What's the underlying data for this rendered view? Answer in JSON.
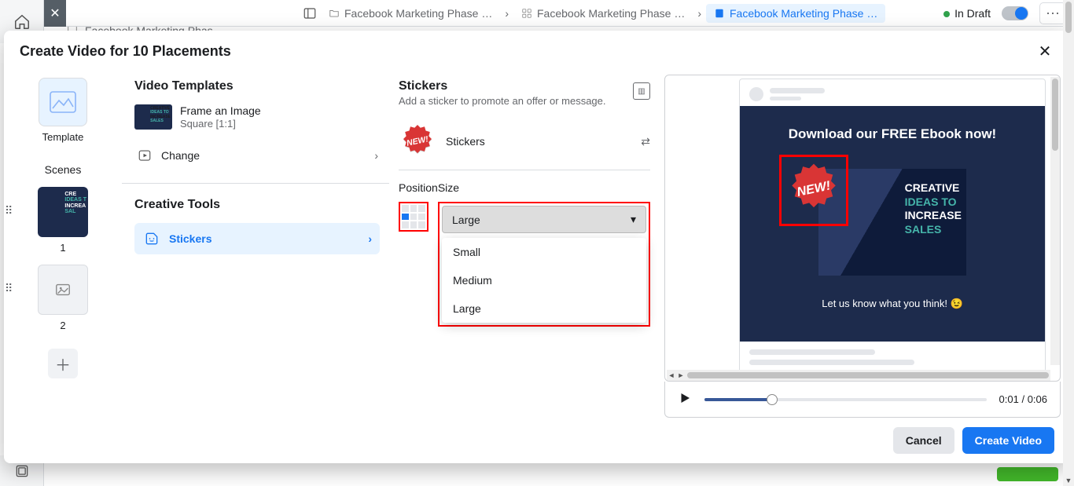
{
  "top": {
    "crumbs": [
      {
        "label": "Facebook Marketing Phase …"
      },
      {
        "label": "Facebook Marketing Phase …"
      },
      {
        "label": "Facebook Marketing Phase …"
      }
    ],
    "sub_tab": "Facebook Marketing Phas…",
    "status_label": "In Draft"
  },
  "modal": {
    "title": "Create Video for 10 Placements",
    "template": {
      "card_label": "Template",
      "scenes_label": "Scenes",
      "scenes": [
        {
          "num": "1"
        },
        {
          "num": "2"
        }
      ]
    },
    "video_templates": {
      "heading": "Video Templates",
      "frame_title": "Frame an Image",
      "frame_sub": "Square [1:1]",
      "change_label": "Change"
    },
    "creative_tools": {
      "heading": "Creative Tools",
      "stickers_label": "Stickers"
    },
    "stickers_panel": {
      "heading": "Stickers",
      "sub": "Add a sticker to promote an offer or message.",
      "row_label": "Stickers",
      "pos_label": "Position",
      "size_label": "Size",
      "size_selected": "Large",
      "size_options": [
        "Small",
        "Medium",
        "Large"
      ]
    },
    "preview": {
      "headline": "Download our FREE Ebook now!",
      "graphic_line1": "CREATIVE",
      "graphic_line2": "IDEAS TO",
      "graphic_line3": "INCREASE",
      "graphic_line4": "SALES",
      "badge_text": "NEW!",
      "caption": "Let us know what you think! 😉",
      "time_elapsed": "0:01",
      "time_total": "0:06"
    },
    "footer": {
      "cancel": "Cancel",
      "create": "Create Video"
    }
  }
}
